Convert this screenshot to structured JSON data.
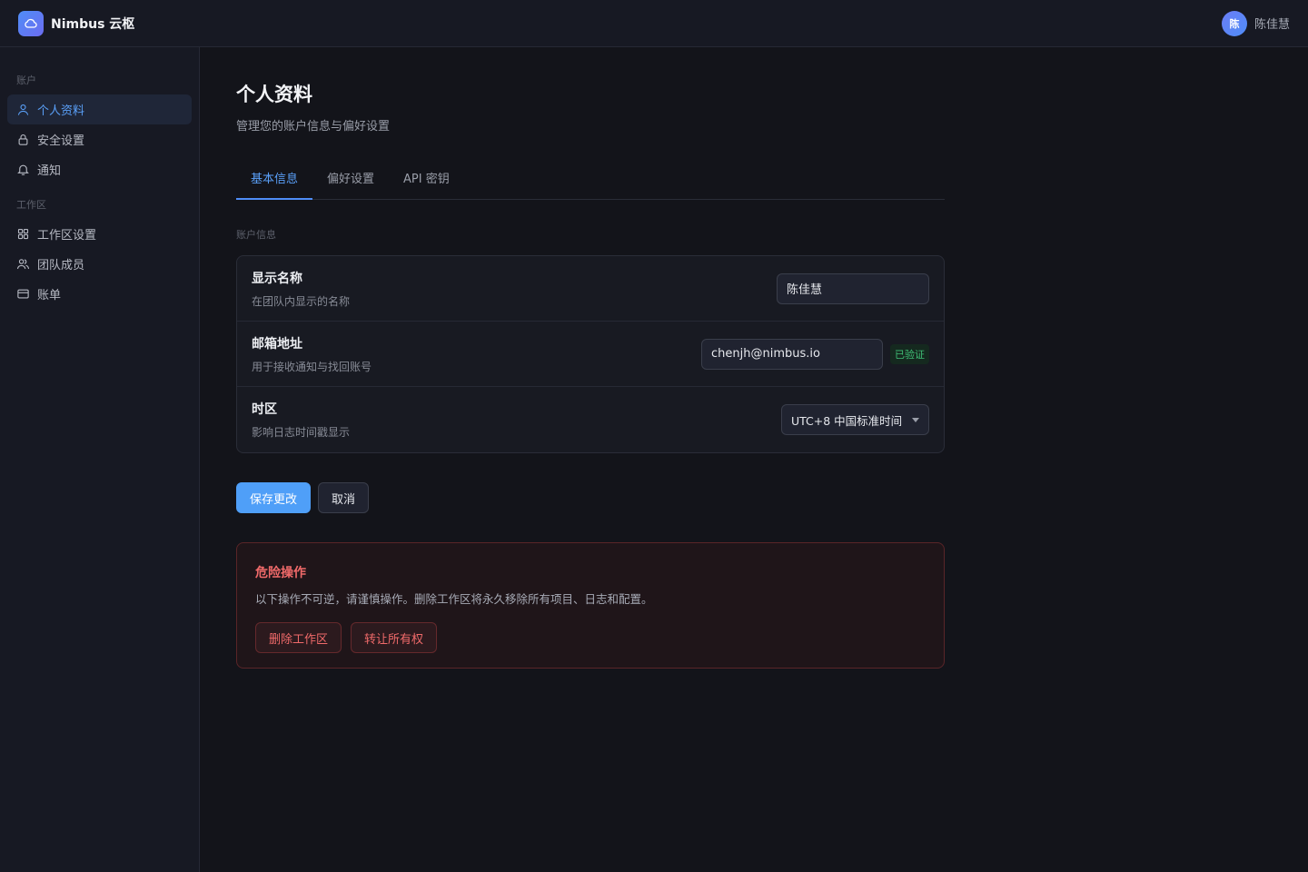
{
  "app": {
    "name": "Nimbus 云枢"
  },
  "user": {
    "avatar_text": "陈",
    "name": "陈佳慧"
  },
  "sidebar": {
    "sections": [
      {
        "title": "账户",
        "items": [
          {
            "label": "个人资料",
            "icon": "user-icon",
            "active": true
          },
          {
            "label": "安全设置",
            "icon": "lock-icon"
          },
          {
            "label": "通知",
            "icon": "bell-icon"
          }
        ]
      },
      {
        "title": "工作区",
        "items": [
          {
            "label": "工作区设置",
            "icon": "grid-icon"
          },
          {
            "label": "团队成员",
            "icon": "users-icon"
          },
          {
            "label": "账单",
            "icon": "card-icon"
          }
        ]
      }
    ]
  },
  "page": {
    "title": "个人资料",
    "subtitle": "管理您的账户信息与偏好设置",
    "tabs": [
      {
        "label": "基本信息",
        "active": true
      },
      {
        "label": "偏好设置"
      },
      {
        "label": "API 密钥"
      }
    ],
    "section_label": "账户信息"
  },
  "form": {
    "display_name": {
      "label": "显示名称",
      "desc": "在团队内显示的名称",
      "value": "陈佳慧"
    },
    "email": {
      "label": "邮箱地址",
      "desc": "用于接收通知与找回账号",
      "value": "chenjh@nimbus.io",
      "badge": "已验证"
    },
    "timezone": {
      "label": "时区",
      "desc": "影响日志时间戳显示",
      "value": "UTC+8 中国标准时间"
    }
  },
  "actions": {
    "save": "保存更改",
    "cancel": "取消"
  },
  "danger": {
    "title": "危险操作",
    "desc": "以下操作不可逆，请谨慎操作。删除工作区将永久移除所有项目、日志和配置。",
    "delete": "删除工作区",
    "transfer": "转让所有权"
  },
  "colors": {
    "accent": "#4f9ff8",
    "danger": "#f06a6a",
    "success": "#3fbf76"
  }
}
